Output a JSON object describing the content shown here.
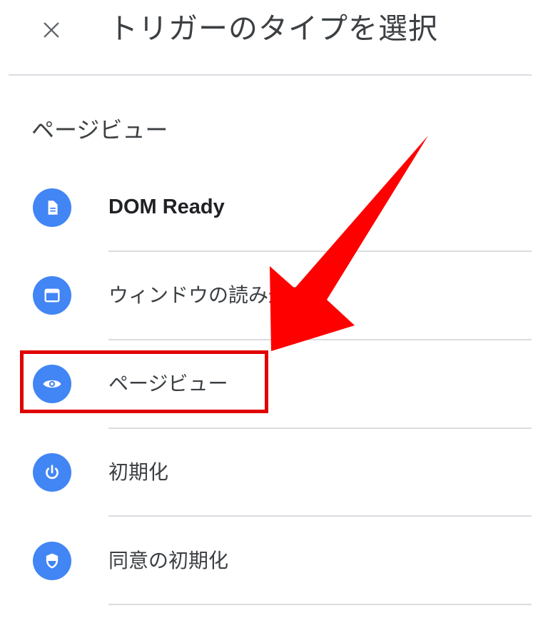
{
  "header": {
    "close_icon": "close-icon",
    "title": "トリガーのタイプを選択"
  },
  "section": {
    "title": "ページビュー"
  },
  "items": [
    {
      "label": "DOM Ready",
      "icon": "document-icon"
    },
    {
      "label": "ウィンドウの読み込み",
      "icon": "window-icon"
    },
    {
      "label": "ページビュー",
      "icon": "eye-icon"
    },
    {
      "label": "初期化",
      "icon": "power-icon"
    },
    {
      "label": "同意の初期化",
      "icon": "shield-icon"
    }
  ],
  "colors": {
    "icon_background": "#4285f4",
    "annotation_red": "#e00000",
    "divider": "#dadce0"
  }
}
